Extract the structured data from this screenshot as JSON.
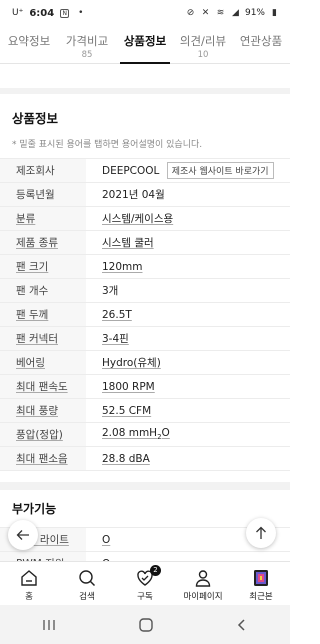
{
  "status": {
    "carrier": "U⁺",
    "time": "6:04",
    "battery": "91%"
  },
  "tabs": [
    {
      "label": "요약정보",
      "count": ""
    },
    {
      "label": "가격비교",
      "count": "85"
    },
    {
      "label": "상품정보",
      "count": ""
    },
    {
      "label": "의견/리뷰",
      "count": "10"
    },
    {
      "label": "연관상품",
      "count": ""
    }
  ],
  "product_info": {
    "title": "상품정보",
    "note": "* 밑줄 표시된 용어를 탭하면 용어설명이 있습니다.",
    "maker_button": "제조사 웹사이트 바로가기",
    "rows": [
      {
        "key": "제조회사",
        "value": "DEEPCOOL"
      },
      {
        "key": "등록년월",
        "value": "2021년 04월"
      },
      {
        "key": "분류",
        "value": "시스템/케이스용"
      },
      {
        "key": "제품 종류",
        "value": "시스템 쿨러"
      },
      {
        "key": "팬 크기",
        "value": "120mm"
      },
      {
        "key": "팬 개수",
        "value": "3개"
      },
      {
        "key": "팬 두께",
        "value": "26.5T"
      },
      {
        "key": "팬 커넥터",
        "value": "3-4핀"
      },
      {
        "key": "베어링",
        "value": "Hydro(유체)"
      },
      {
        "key": "최대 팬속도",
        "value": "1800 RPM"
      },
      {
        "key": "최대 풍량",
        "value": "52.5 CFM"
      },
      {
        "key": "풍압(정압)",
        "value": "2.08 mmH",
        "value_sub": "2",
        "value_suffix": "O"
      },
      {
        "key": "최대 팬소음",
        "value": "28.8 dBA"
      }
    ]
  },
  "extra_features": {
    "title": "부가기능",
    "rows": [
      {
        "key": "LED 라이트",
        "value": "O"
      },
      {
        "key": "PWM 지원",
        "value": "O"
      }
    ]
  },
  "bottom_nav": [
    {
      "label": "홈",
      "icon": "home-icon"
    },
    {
      "label": "검색",
      "icon": "search-icon"
    },
    {
      "label": "구독",
      "icon": "heart-check-icon",
      "badge": "2"
    },
    {
      "label": "마이페이지",
      "icon": "person-icon"
    },
    {
      "label": "최근본",
      "icon": "recent-thumbnail-icon"
    }
  ]
}
